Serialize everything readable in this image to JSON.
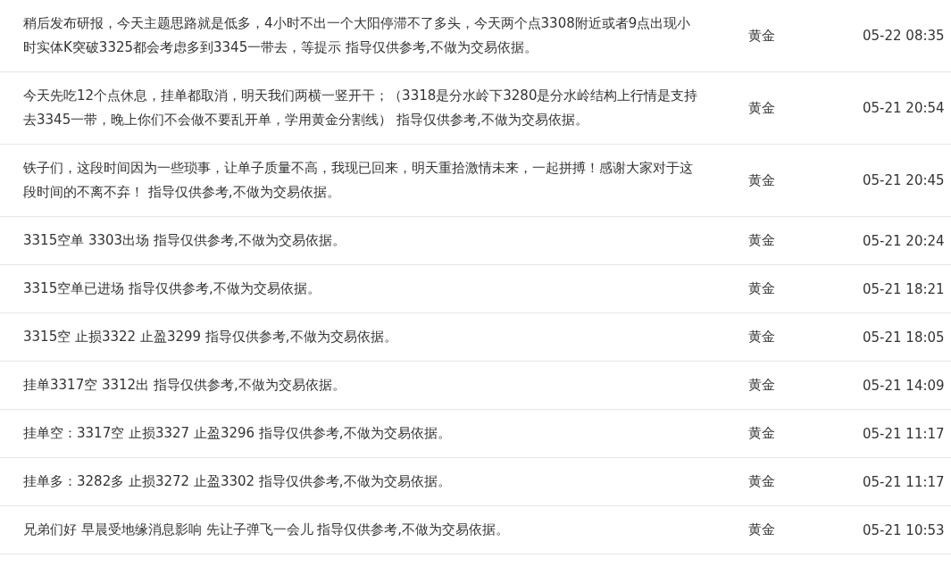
{
  "rows": [
    {
      "message": "稍后发布研报，今天主题思路就是低多，4小时不出一个大阳停滞不了多头，今天两个点3308附近或者9点出现小时实体K突破3325都会考虑多到3345一带去，等提示 指导仅供参考,不做为交易依据。",
      "category": "黄金",
      "time": "05-22 08:35"
    },
    {
      "message": "今天先吃12个点休息，挂单都取消，明天我们两横一竖开干；（3318是分水岭下3280是分水岭结构上行情是支持去3345一带，晚上你们不会做不要乱开单，学用黄金分割线） 指导仅供参考,不做为交易依据。",
      "category": "黄金",
      "time": "05-21 20:54"
    },
    {
      "message": "铁子们，这段时间因为一些琐事，让单子质量不高，我现已回来，明天重拾激情未来，一起拼搏！感谢大家对于这段时间的不离不弃！ 指导仅供参考,不做为交易依据。",
      "category": "黄金",
      "time": "05-21 20:45"
    },
    {
      "message": "3315空单 3303出场 指导仅供参考,不做为交易依据。",
      "category": "黄金",
      "time": "05-21 20:24"
    },
    {
      "message": "3315空单已进场 指导仅供参考,不做为交易依据。",
      "category": "黄金",
      "time": "05-21 18:21"
    },
    {
      "message": "3315空 止损3322 止盈3299 指导仅供参考,不做为交易依据。",
      "category": "黄金",
      "time": "05-21 18:05"
    },
    {
      "message": "挂单3317空 3312出 指导仅供参考,不做为交易依据。",
      "category": "黄金",
      "time": "05-21 14:09"
    },
    {
      "message": "挂单空：3317空 止损3327 止盈3296 指导仅供参考,不做为交易依据。",
      "category": "黄金",
      "time": "05-21 11:17"
    },
    {
      "message": "挂单多：3282多 止损3272 止盈3302 指导仅供参考,不做为交易依据。",
      "category": "黄金",
      "time": "05-21 11:17"
    },
    {
      "message": "兄弟们好 早晨受地缘消息影响 先让子弹飞一会儿 指导仅供参考,不做为交易依据。",
      "category": "黄金",
      "time": "05-21 10:53"
    }
  ]
}
